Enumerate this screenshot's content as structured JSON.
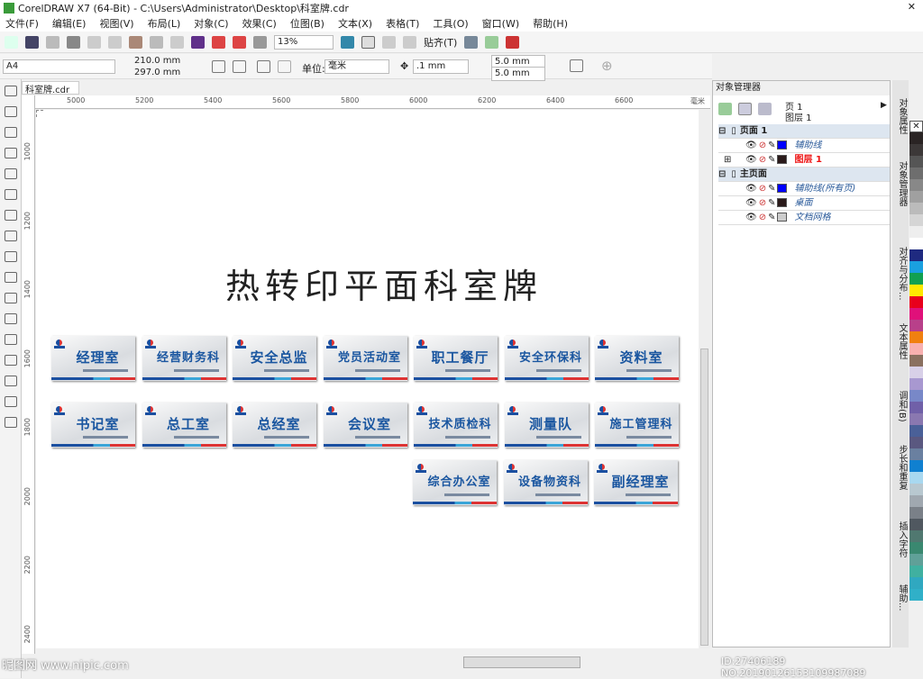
{
  "window": {
    "title": "CorelDRAW X7 (64-Bit) - C:\\Users\\Administrator\\Desktop\\科室牌.cdr"
  },
  "menu": [
    "文件(F)",
    "编辑(E)",
    "视图(V)",
    "布局(L)",
    "对象(C)",
    "效果(C)",
    "位图(B)",
    "文本(X)",
    "表格(T)",
    "工具(O)",
    "窗口(W)",
    "帮助(H)"
  ],
  "toolbar": {
    "zoom": "13%",
    "snap": "贴齐(T)"
  },
  "propbar": {
    "page_size": "A4",
    "width": "210.0 mm",
    "height": "297.0 mm",
    "unit_label": "单位:",
    "unit": "毫米",
    "nudge": ".1 mm",
    "dup_x": "5.0 mm",
    "dup_y": "5.0 mm"
  },
  "doc_tab": "科室牌.cdr",
  "rulers": {
    "h": [
      "5000",
      "5200",
      "5400",
      "5600",
      "5800",
      "6000",
      "6200",
      "6400",
      "6600"
    ],
    "h_unit": "毫米",
    "v": [
      "1000",
      "1200",
      "1400",
      "1600",
      "1800",
      "2000",
      "2200",
      "2400"
    ]
  },
  "canvas": {
    "heading": "热转印平面科室牌",
    "signs": [
      [
        "经理室",
        "经营财务科",
        "安全总监",
        "党员活动室",
        "职工餐厅",
        "安全环保科",
        "资料室"
      ],
      [
        "书记室",
        "总工室",
        "总经室",
        "会议室",
        "技术质检科",
        "测量队",
        "施工管理科"
      ],
      [
        "综合办公室",
        "设备物资科",
        "副经理室"
      ]
    ]
  },
  "object_manager": {
    "title": "对象管理器",
    "page": "页 1",
    "layer": "图层 1",
    "rows": [
      {
        "label": "页面 1",
        "group": true
      },
      {
        "label": "辅助线",
        "color": "#0000ff"
      },
      {
        "label": "图层 1",
        "color": "#2a1a1a",
        "active": true
      },
      {
        "label": "主页面",
        "group": true
      },
      {
        "label": "辅助线(所有页)",
        "color": "#0000ff"
      },
      {
        "label": "桌面",
        "color": "#2a1a1a"
      },
      {
        "label": "文档网格",
        "color": "#cccccc"
      }
    ]
  },
  "side_tabs": [
    "对象属性",
    "对象管理器",
    "对齐与分布...",
    "文本属性",
    "调和(B)",
    "步长和重复",
    "插入字符",
    "辅助..."
  ],
  "palette": [
    "#2a2424",
    "#3c3838",
    "#555",
    "#6e6e6e",
    "#888",
    "#a0a0a0",
    "#bbb",
    "#d5d5d5",
    "#eee",
    "#fff",
    "#1f2a80",
    "#1aa0e0",
    "#11a050",
    "#ffe800",
    "#e8001c",
    "#e0107a",
    "#b8408a",
    "#f08010",
    "#f8b0b0",
    "#8a7060",
    "#d8d0e8",
    "#a898d0",
    "#7888c8",
    "#7060a8",
    "#8a78b0",
    "#4a6098",
    "#5a5880",
    "#6a80a0",
    "#1080d0",
    "#a8d8f0",
    "#b8c8d0",
    "#a0a8b0",
    "#7a8088",
    "#505860",
    "#507870",
    "#3a8870",
    "#60a098",
    "#40b0a0",
    "#30a8c0",
    "#30b0c8"
  ],
  "watermark": {
    "left": "昵图网 www.nipic.com",
    "right": "ID:27406189 NO:20190126153109987089"
  }
}
